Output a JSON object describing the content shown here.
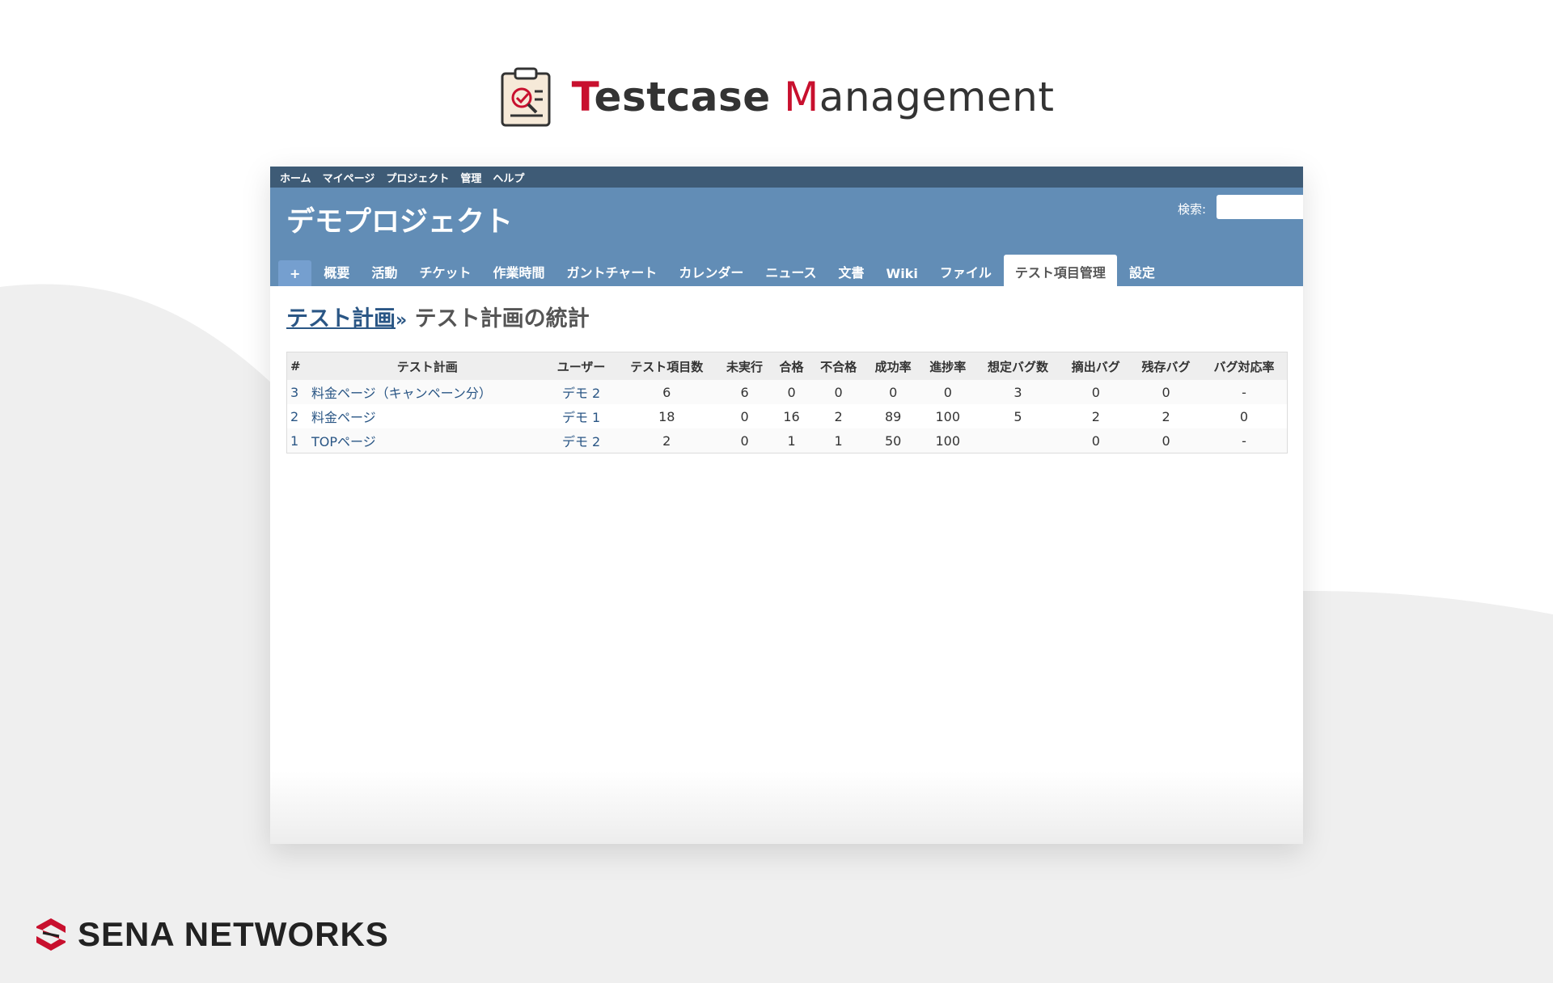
{
  "hero": {
    "title_first_cap": "T",
    "title_first_rest": "estcase",
    "title_second_cap": "M",
    "title_second_rest": "anagement"
  },
  "topbar": {
    "items": [
      "ホーム",
      "マイページ",
      "プロジェクト",
      "管理",
      "ヘルプ"
    ]
  },
  "header": {
    "project_title": "デモプロジェクト",
    "search_label": "検索:",
    "search_value": ""
  },
  "tabs": {
    "plus": "+",
    "items": [
      "概要",
      "活動",
      "チケット",
      "作業時間",
      "ガントチャート",
      "カレンダー",
      "ニュース",
      "文書",
      "Wiki",
      "ファイル",
      "テスト項目管理",
      "設定"
    ],
    "selected": "テスト項目管理"
  },
  "page": {
    "breadcrumb_link": "テスト計画",
    "separator": "»",
    "title": "テスト計画の統計"
  },
  "table": {
    "headers": [
      "#",
      "テスト計画",
      "ユーザー",
      "テスト項目数",
      "未実行",
      "合格",
      "不合格",
      "成功率",
      "進捗率",
      "想定バグ数",
      "摘出バグ",
      "残存バグ",
      "バグ対応率"
    ],
    "rows": [
      {
        "id": "3",
        "plan": "料金ページ（キャンペーン分）",
        "user": "デモ 2",
        "items": "6",
        "not_run": "6",
        "pass": "0",
        "fail": "0",
        "success_rate": "0",
        "progress": "0",
        "expected_bugs": "3",
        "found_bugs": "0",
        "remaining_bugs": "0",
        "bug_rate": "-"
      },
      {
        "id": "2",
        "plan": "料金ページ",
        "user": "デモ 1",
        "items": "18",
        "not_run": "0",
        "pass": "16",
        "fail": "2",
        "success_rate": "89",
        "progress": "100",
        "expected_bugs": "5",
        "found_bugs": "2",
        "remaining_bugs": "2",
        "bug_rate": "0"
      },
      {
        "id": "1",
        "plan": "TOPページ",
        "user": "デモ 2",
        "items": "2",
        "not_run": "0",
        "pass": "1",
        "fail": "1",
        "success_rate": "50",
        "progress": "100",
        "expected_bugs": "",
        "found_bugs": "0",
        "remaining_bugs": "0",
        "bug_rate": "-"
      }
    ]
  },
  "brand": {
    "name": "SENA NETWORKS"
  },
  "colors": {
    "accent_red": "#c8102e",
    "topbar": "#3e5b76",
    "header": "#628db6",
    "link": "#2a5685"
  }
}
